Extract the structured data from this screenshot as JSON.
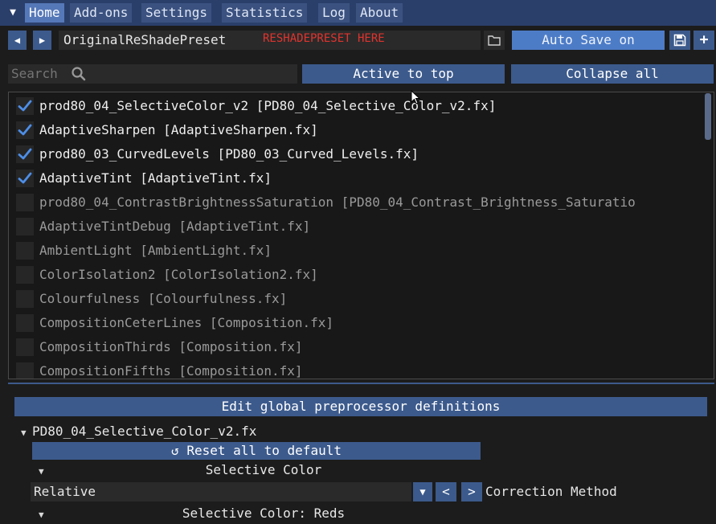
{
  "tabs": [
    "Home",
    "Add-ons",
    "Settings",
    "Statistics",
    "Log",
    "About"
  ],
  "active_tab": "Home",
  "preset": {
    "name": "OriginalReShadePreset",
    "note": "RESHADEPRESET HERE",
    "prev_icon": "triangle-left-icon",
    "next_icon": "triangle-right-icon",
    "folder_icon": "folder-icon",
    "auto_save_label": "Auto Save on",
    "save_icon": "floppy-disk-icon",
    "add_icon": "plus-icon"
  },
  "search": {
    "placeholder": "Search",
    "icon": "magnifier-icon"
  },
  "buttons": {
    "active_to_top": "Active to top",
    "collapse_all": "Collapse all"
  },
  "effects": [
    {
      "label": "prod80_04_SelectiveColor_v2 [PD80_04_Selective_Color_v2.fx]",
      "enabled": true
    },
    {
      "label": "AdaptiveSharpen [AdaptiveSharpen.fx]",
      "enabled": true
    },
    {
      "label": "prod80_03_CurvedLevels [PD80_03_Curved_Levels.fx]",
      "enabled": true
    },
    {
      "label": "AdaptiveTint [AdaptiveTint.fx]",
      "enabled": true
    },
    {
      "label": "prod80_04_ContrastBrightnessSaturation [PD80_04_Contrast_Brightness_Saturatio",
      "enabled": false
    },
    {
      "label": "AdaptiveTintDebug [AdaptiveTint.fx]",
      "enabled": false
    },
    {
      "label": "AmbientLight [AmbientLight.fx]",
      "enabled": false
    },
    {
      "label": "ColorIsolation2 [ColorIsolation2.fx]",
      "enabled": false
    },
    {
      "label": "Colourfulness [Colourfulness.fx]",
      "enabled": false
    },
    {
      "label": "CompositionCeterLines [Composition.fx]",
      "enabled": false
    },
    {
      "label": "CompositionThirds [Composition.fx]",
      "enabled": false
    },
    {
      "label": "CompositionFifths [Composition.fx]",
      "enabled": false
    }
  ],
  "bottom": {
    "global_defs_label": "Edit global preprocessor definitions",
    "effect_file": "PD80_04_Selective_Color_v2.fx",
    "reset_label": "Reset all to default",
    "reset_icon": "reset-arrow-icon",
    "section_selective_color": "Selective Color",
    "combo_value": "Relative",
    "combo_icon": "chevron-down-icon",
    "prev_label": "<",
    "next_label": ">",
    "correction_label": "Correction Method",
    "section_reds": "Selective Color: Reds"
  },
  "colors": {
    "accent": "#4d7cc7",
    "button": "#3c5a8c",
    "tab_bar": "#2b3f6b",
    "note_red": "#e0342e"
  }
}
